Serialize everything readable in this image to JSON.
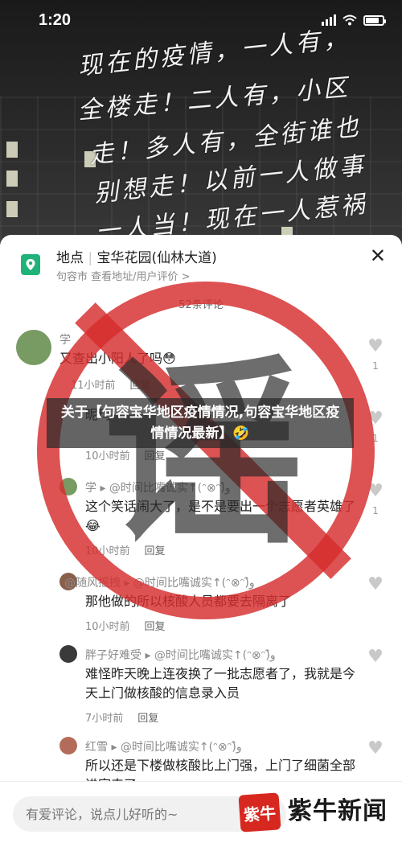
{
  "status": {
    "time": "1:20"
  },
  "background": {
    "handwriting": [
      "现在的疫情，一人有，",
      "全楼走！二人有，小区",
      "走！多人有，全街谁也",
      "别想走！以前一人做事",
      "一人当！现在一人惹祸"
    ]
  },
  "location": {
    "label": "地点",
    "place": "宝华花园(仙林大道)",
    "city": "句容市",
    "links": "查看地址/用户评价 >"
  },
  "comments_header": "52条评论",
  "comments": [
    {
      "name": "学",
      "text": "又查出小阳人了吗😳",
      "time": "11小时前",
      "reply": "回复",
      "likes": "1"
    },
    {
      "name": "",
      "text": "昵玛",
      "time": "10小时前",
      "reply": "回复",
      "likes": "1"
    },
    {
      "name": "学 ▸ @时间比嘴诚实↑(ᵔ⊗ᵔ)و̑̑",
      "text": "这个笑话闹大了，是不是要出一个志愿者英雄了😂",
      "time": "10小时前",
      "reply": "回复",
      "likes": "1"
    },
    {
      "name": "@随风摇拽 ▸ @时间比嘴诚实↑(ᵔ⊗ᵔ)و̑̑",
      "text": "那他做的所以核酸人员都要去隔离了",
      "time": "10小时前",
      "reply": "回复",
      "likes": ""
    },
    {
      "name": "胖子好难受 ▸ @时间比嘴诚实↑(ᵔ⊗ᵔ)و̑̑",
      "text": "难怪昨天晚上连夜换了一批志愿者了，我就是今天上门做核酸的信息录入员",
      "time": "7小时前",
      "reply": "回复",
      "likes": ""
    },
    {
      "name": "红雪 ▸ @时间比嘴诚实↑(ᵔ⊗ᵔ)و̑̑",
      "text": "所以还是下楼做核酸比上门强，上门了细菌全部进家来了",
      "time": "",
      "reply": "",
      "likes": ""
    }
  ],
  "input": {
    "placeholder": "有爱评论，说点儿好听的~"
  },
  "headline": "关于【句容宝华地区疫情情况,句容宝华地区疫情情况最新】🤣",
  "stamp_char": "谣",
  "watermark": {
    "logo": "紫牛",
    "text": "紫牛新闻"
  },
  "colors": {
    "brand_green": "#1fb37a",
    "stamp_red": "#d62c2c",
    "watermark_red": "#d7281f"
  }
}
